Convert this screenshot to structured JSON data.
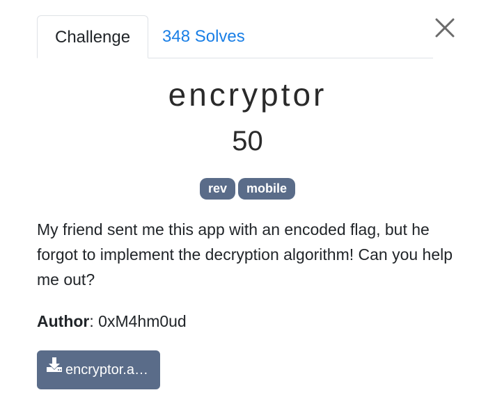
{
  "tabs": [
    {
      "label": "Challenge",
      "active": true
    },
    {
      "label": "348 Solves",
      "active": false
    }
  ],
  "challenge": {
    "name": "encryptor",
    "points": "50",
    "tags": [
      "rev",
      "mobile"
    ],
    "description": "My friend sent me this app with an encoded flag, but he forgot to implement the decryption algorithm! Can you help me out?",
    "author_label": "Author",
    "author_sep": ": ",
    "author": "0xM4hm0ud",
    "file_label": "encryptor.a…"
  },
  "icons": {
    "close": "close-icon",
    "download": "download-icon"
  },
  "colors": {
    "accent_link": "#1a7fe6",
    "badge_bg": "#5a6c89",
    "button_bg": "#5a6c89"
  }
}
